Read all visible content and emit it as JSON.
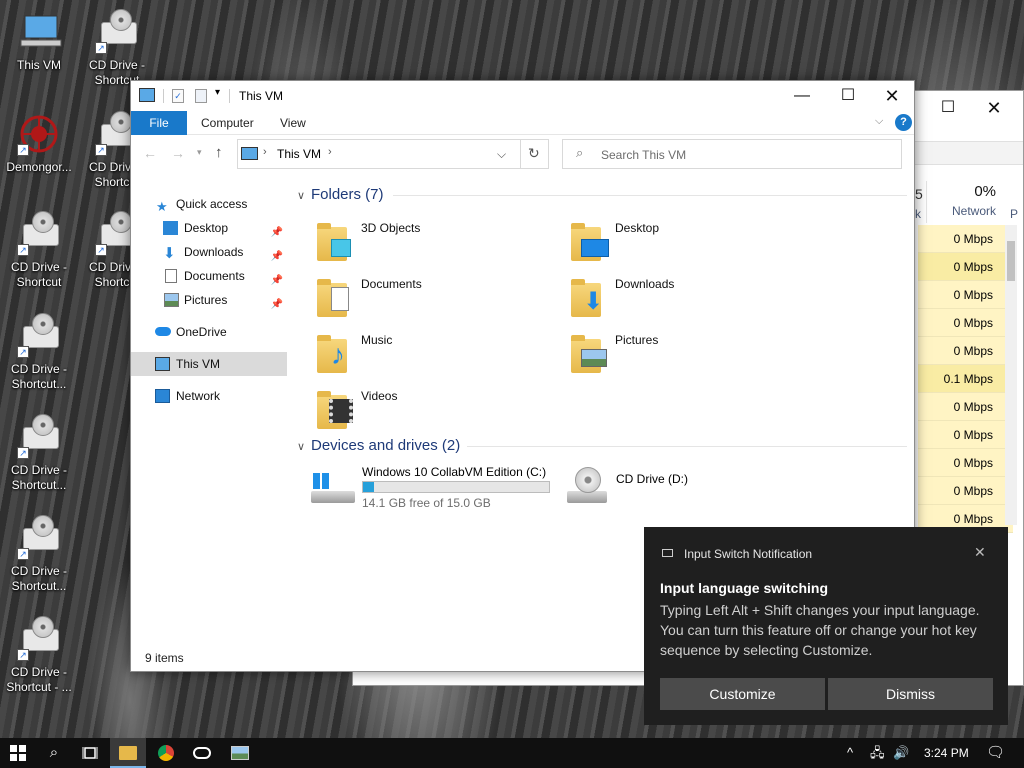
{
  "desktop": {
    "icons": [
      {
        "label": "This VM",
        "icon": "computer-icon"
      },
      {
        "label": "CD Drive - Shortcut",
        "icon": "cd-drive-icon"
      },
      {
        "label": "Demongor...",
        "icon": "demon-icon"
      },
      {
        "label": "CD Drive - Shortcut",
        "icon": "cd-drive-icon"
      },
      {
        "label": "CD Drive - Shortcut",
        "icon": "cd-drive-icon"
      },
      {
        "label": "CD Drive - Shortcut",
        "icon": "cd-drive-icon"
      },
      {
        "label": "CD Drive - Shortcut...",
        "icon": "cd-drive-icon"
      },
      {
        "label": "CD Drive - Shortcut...",
        "icon": "cd-drive-icon"
      },
      {
        "label": "CD Drive - Shortcut...",
        "icon": "cd-drive-icon"
      },
      {
        "label": "CD Drive - Shortcut - ...",
        "icon": "cd-drive-icon"
      }
    ]
  },
  "task_manager": {
    "network_percent": "0%",
    "network_label": "Network",
    "rows": [
      "0 Mbps",
      "0 Mbps",
      "0 Mbps",
      "0 Mbps",
      "0 Mbps",
      "0.1 Mbps",
      "0 Mbps",
      "0 Mbps",
      "0 Mbps",
      "0 Mbps",
      "0 Mbps"
    ]
  },
  "explorer": {
    "title": "This VM",
    "ribbon_tabs": [
      "File",
      "Computer",
      "View"
    ],
    "address": "This VM",
    "search_placeholder": "Search This VM",
    "nav": {
      "quick_access": "Quick access",
      "items": [
        "Desktop",
        "Downloads",
        "Documents",
        "Pictures"
      ],
      "onedrive": "OneDrive",
      "this_vm": "This VM",
      "network": "Network"
    },
    "folders_header": "Folders (7)",
    "folders": [
      "3D Objects",
      "Desktop",
      "Documents",
      "Downloads",
      "Music",
      "Pictures",
      "Videos"
    ],
    "devices_header": "Devices and drives (2)",
    "drive_c": {
      "name": "Windows 10 CollabVM Edition (C:)",
      "free": "14.1 GB free of 15.0 GB",
      "used_fraction": 0.06
    },
    "drive_d": {
      "name": "CD Drive (D:)"
    },
    "status": "9 items"
  },
  "notification": {
    "app": "Input Switch Notification",
    "title": "Input language switching",
    "body": "Typing Left Alt + Shift changes your input language. You can turn this feature off or change your hot key sequence by selecting Customize.",
    "customize": "Customize",
    "dismiss": "Dismiss"
  },
  "taskbar": {
    "time": "3:24 PM"
  },
  "colors": {
    "accent": "#1979ca",
    "selection": "#cce8ff",
    "notification_bg": "#1f1f1f"
  }
}
